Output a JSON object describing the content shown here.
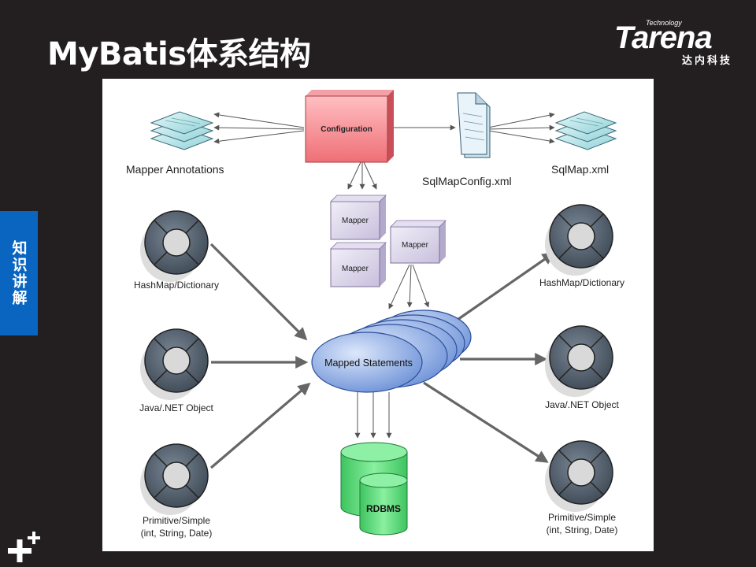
{
  "slide": {
    "title": "MyBatis体系结构",
    "side_tab": "知识讲解"
  },
  "brand": {
    "tagline": "Technology",
    "name": "Tarena",
    "cn_name": "达内科技"
  },
  "diagram": {
    "configuration": "Configuration",
    "mapper_annotations": "Mapper Annotations",
    "sqlmapconfig": "SqlMapConfig.xml",
    "sqlmap": "SqlMap.xml",
    "mapper": "Mapper",
    "mapped_statements": "Mapped Statements",
    "rdbms": "RDBMS",
    "inputs": {
      "hashmap": "HashMap/Dictionary",
      "object": "Java/.NET Object",
      "primitive_1": "Primitive/Simple",
      "primitive_2": "(int, String, Date)"
    },
    "outputs": {
      "hashmap": "HashMap/Dictionary",
      "object": "Java/.NET Object",
      "primitive_1": "Primitive/Simple",
      "primitive_2": "(int, String, Date)"
    }
  },
  "colors": {
    "background": "#231f20",
    "accent_blue": "#0a65c0",
    "configuration_fill": "#f28a8f",
    "mapper_fill": "#ddd6ec",
    "statements_fill": "#7ea2e0",
    "rdbms_fill": "#5fd47a"
  }
}
